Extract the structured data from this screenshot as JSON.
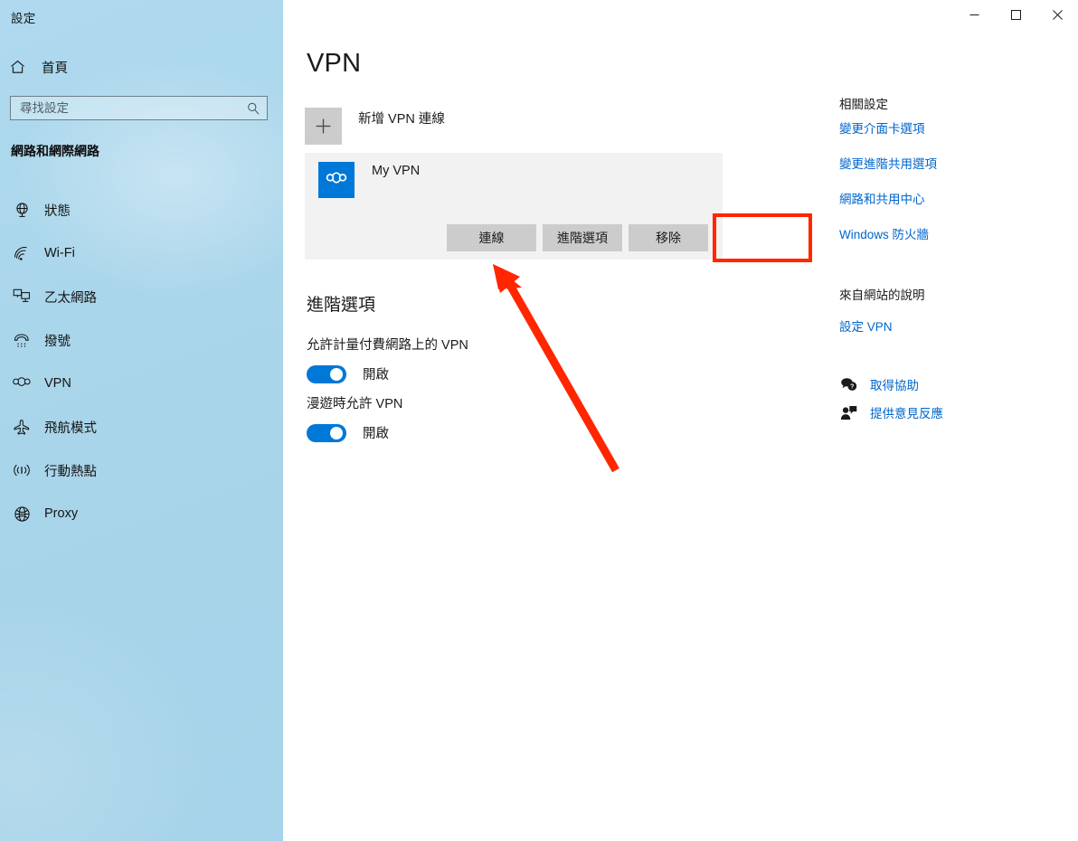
{
  "window": {
    "app_title": "設定",
    "controls": {
      "minimize": "minimize-icon",
      "maximize": "maximize-icon",
      "close": "close-icon"
    }
  },
  "sidebar": {
    "home_label": "首頁",
    "home_icon": "home-icon",
    "search": {
      "placeholder": "尋找設定",
      "value": "",
      "icon": "search-icon"
    },
    "section_header": "網路和網際網路",
    "items": [
      {
        "label": "狀態",
        "icon": "status-globe-icon"
      },
      {
        "label": "Wi-Fi",
        "icon": "wifi-icon"
      },
      {
        "label": "乙太網路",
        "icon": "ethernet-icon"
      },
      {
        "label": "撥號",
        "icon": "dialup-phone-icon"
      },
      {
        "label": "VPN",
        "icon": "vpn-icon"
      },
      {
        "label": "飛航模式",
        "icon": "airplane-icon"
      },
      {
        "label": "行動熱點",
        "icon": "hotspot-icon"
      },
      {
        "label": "Proxy",
        "icon": "globe-icon"
      }
    ]
  },
  "main": {
    "page_title": "VPN",
    "add_connection": {
      "label": "新增 VPN 連線",
      "icon": "plus-icon"
    },
    "connections": [
      {
        "name": "My VPN",
        "icon": "vpn-tile-icon",
        "selected": true,
        "actions": [
          {
            "label": "連線",
            "highlighted": true
          },
          {
            "label": "進階選項",
            "highlighted": false
          },
          {
            "label": "移除",
            "highlighted": false
          }
        ]
      }
    ],
    "advanced": {
      "title": "進階選項",
      "options": [
        {
          "label": "允許計量付費網路上的 VPN",
          "state": "開啟",
          "on": true
        },
        {
          "label": "漫遊時允許 VPN",
          "state": "開啟",
          "on": true
        }
      ]
    }
  },
  "right_panel": {
    "related_heading": "相關設定",
    "related_links": [
      "變更介面卡選項",
      "變更進階共用選項",
      "網路和共用中心",
      "Windows 防火牆"
    ],
    "web_heading": "來自網站的說明",
    "web_links": [
      "設定 VPN"
    ],
    "help_rows": [
      {
        "label": "取得協助",
        "icon": "help-question-bubble-icon"
      },
      {
        "label": "提供意見反應",
        "icon": "feedback-person-icon"
      }
    ]
  },
  "annotation": {
    "highlight_color": "#FF2600",
    "highlight_target": "連線",
    "arrow": "pointer-arrow"
  },
  "colors": {
    "sidebar_bg": "#ACD8EC",
    "accent": "#0078D7",
    "link": "#0066CC",
    "selected_row_bg": "#F2F2F2",
    "button_bg": "#CCCCCC"
  }
}
